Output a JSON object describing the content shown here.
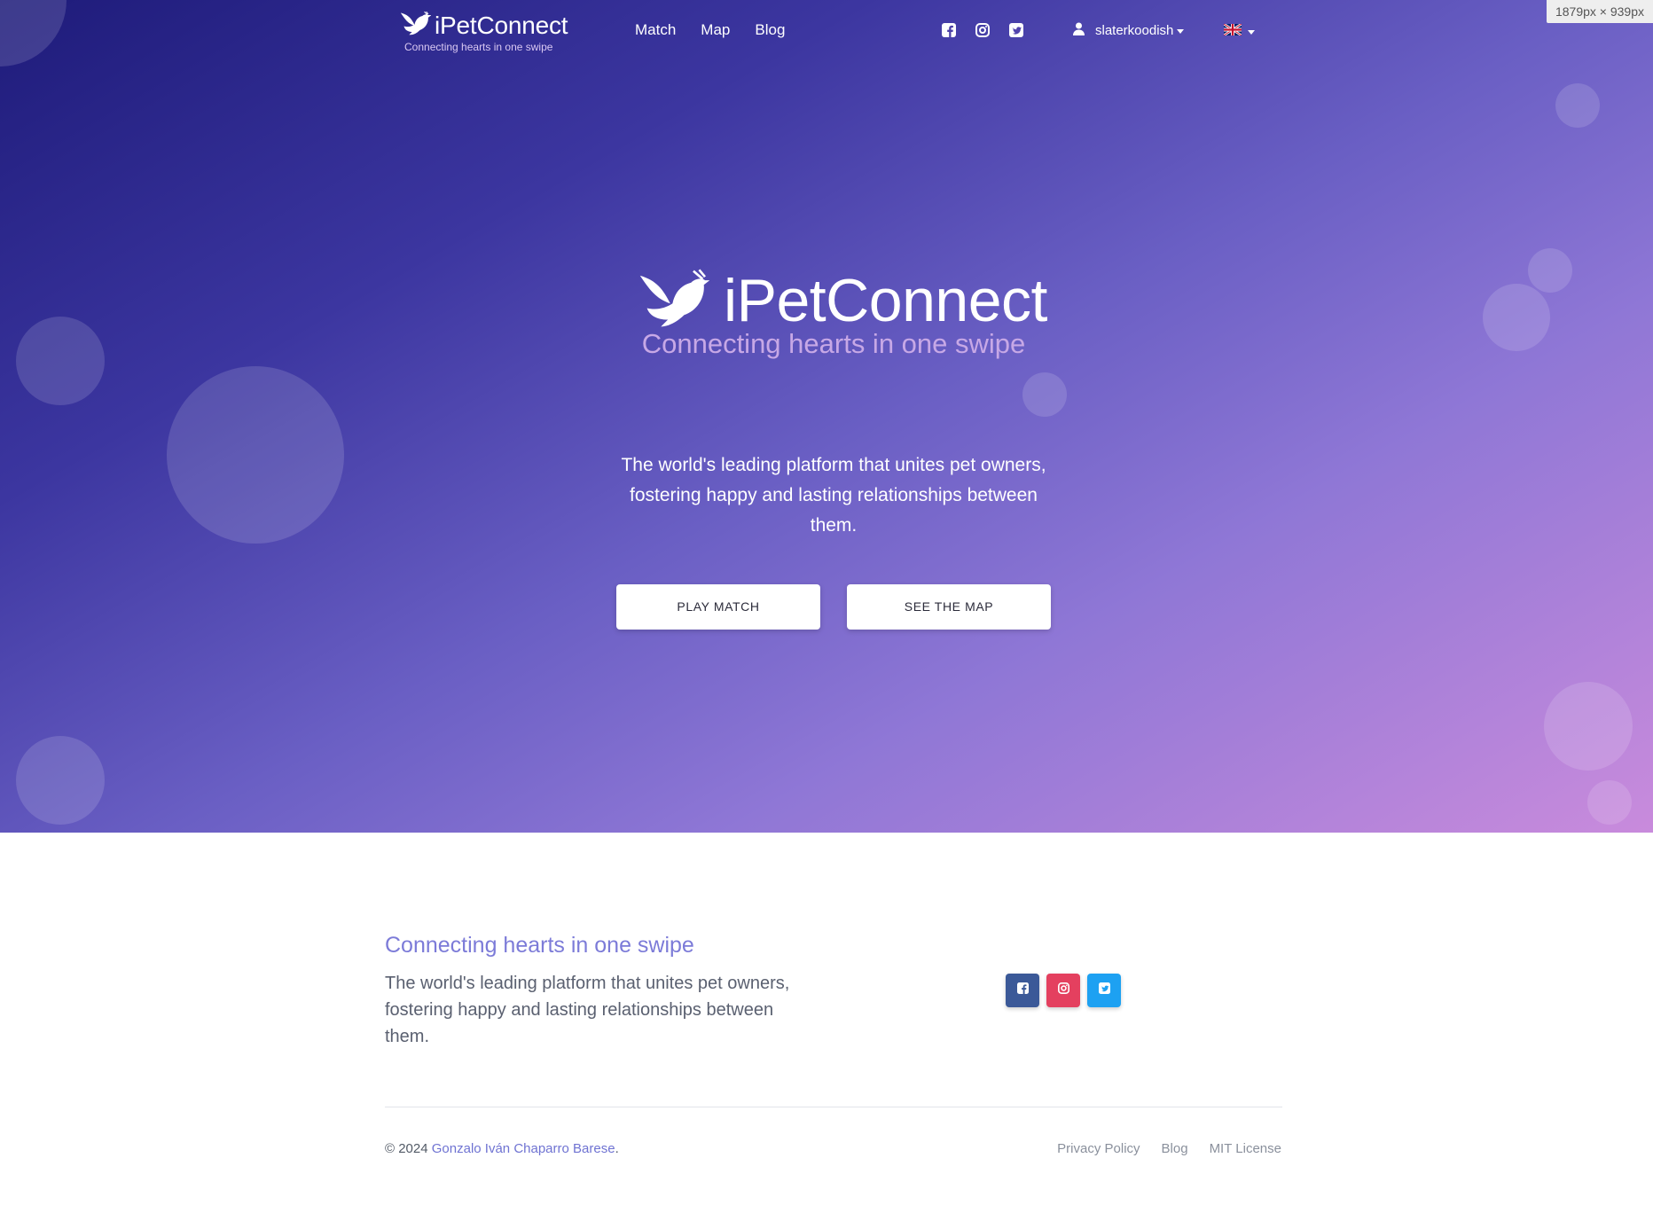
{
  "window_size_label": "1879px × 939px",
  "navbar": {
    "brand_title": "iPetConnect",
    "brand_subtitle": "Connecting hearts in one swipe",
    "links": [
      "Match",
      "Map",
      "Blog"
    ],
    "social_icons": [
      "facebook-icon",
      "instagram-icon",
      "twitter-icon"
    ],
    "username": "slaterkoodish",
    "language": "uk-flag-icon"
  },
  "hero": {
    "title": "iPetConnect",
    "tagline": "Connecting hearts in one swipe",
    "description": "The world's leading platform that unites pet owners, fostering happy and lasting relationships between them.",
    "buttons": {
      "play_match": "PLAY MATCH",
      "see_map": "SEE THE MAP"
    }
  },
  "footer": {
    "tagline": "Connecting hearts in one swipe",
    "description": "The world's leading platform that unites pet owners, fostering happy and lasting relationships between them.",
    "social": [
      {
        "icon": "facebook-icon",
        "color": "#3b5998"
      },
      {
        "icon": "instagram-icon",
        "color": "#e4405f"
      },
      {
        "icon": "twitter-icon",
        "color": "#1da1f2"
      }
    ],
    "copyright_prefix": "© 2024 ",
    "author": "Gonzalo Iván Chaparro Barese",
    "copyright_suffix": ".",
    "links": [
      "Privacy Policy",
      "Blog",
      "MIT License"
    ]
  },
  "colors": {
    "accent": "#7c7bd8",
    "hero_gradient_start": "#1e1b7a",
    "hero_gradient_end": "#c98bdc"
  }
}
